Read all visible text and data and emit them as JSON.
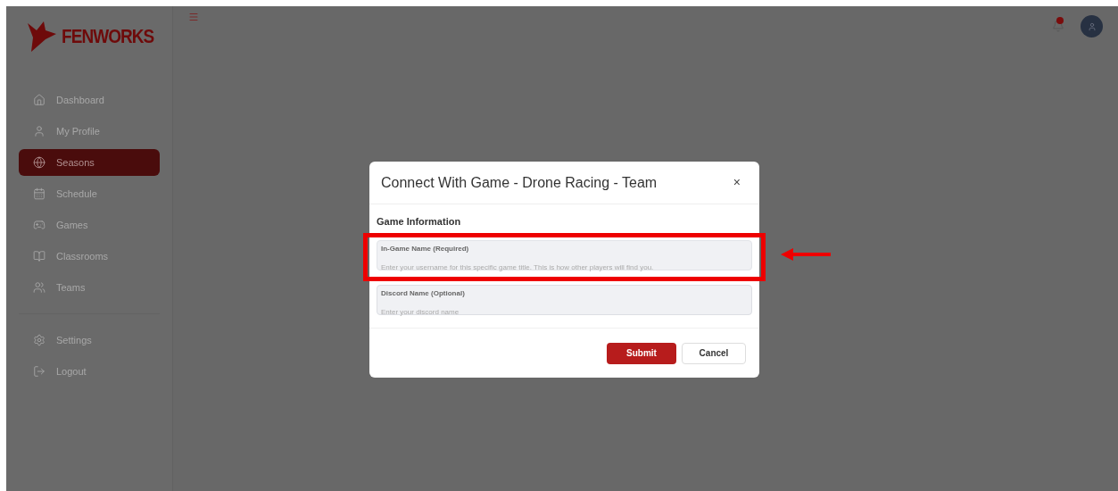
{
  "brand": {
    "name": "FENWORKS"
  },
  "sidebar": {
    "items": [
      {
        "label": "Dashboard",
        "selected": false
      },
      {
        "label": "My Profile",
        "selected": false
      },
      {
        "label": "Seasons",
        "selected": true
      },
      {
        "label": "Schedule",
        "selected": false
      },
      {
        "label": "Games",
        "selected": false
      },
      {
        "label": "Classrooms",
        "selected": false
      },
      {
        "label": "Teams",
        "selected": false
      }
    ],
    "footer_items": [
      {
        "label": "Settings",
        "selected": false
      },
      {
        "label": "Logout",
        "selected": false
      }
    ]
  },
  "header": {
    "notification_dot": true
  },
  "modal": {
    "title": "Connect With Game - Drone Racing - Team",
    "close": "×",
    "section": "Game Information",
    "fields": [
      {
        "label": "In-Game Name (Required)",
        "placeholder": "Enter your username for this specific game title. This is how other players will find you.",
        "highlighted": true
      },
      {
        "label": "Discord Name (Optional)",
        "placeholder": "Enter your discord name",
        "highlighted": false
      }
    ],
    "buttons": [
      {
        "label": "Submit",
        "kind": "primary"
      },
      {
        "label": "Cancel",
        "kind": "secondary"
      }
    ]
  }
}
